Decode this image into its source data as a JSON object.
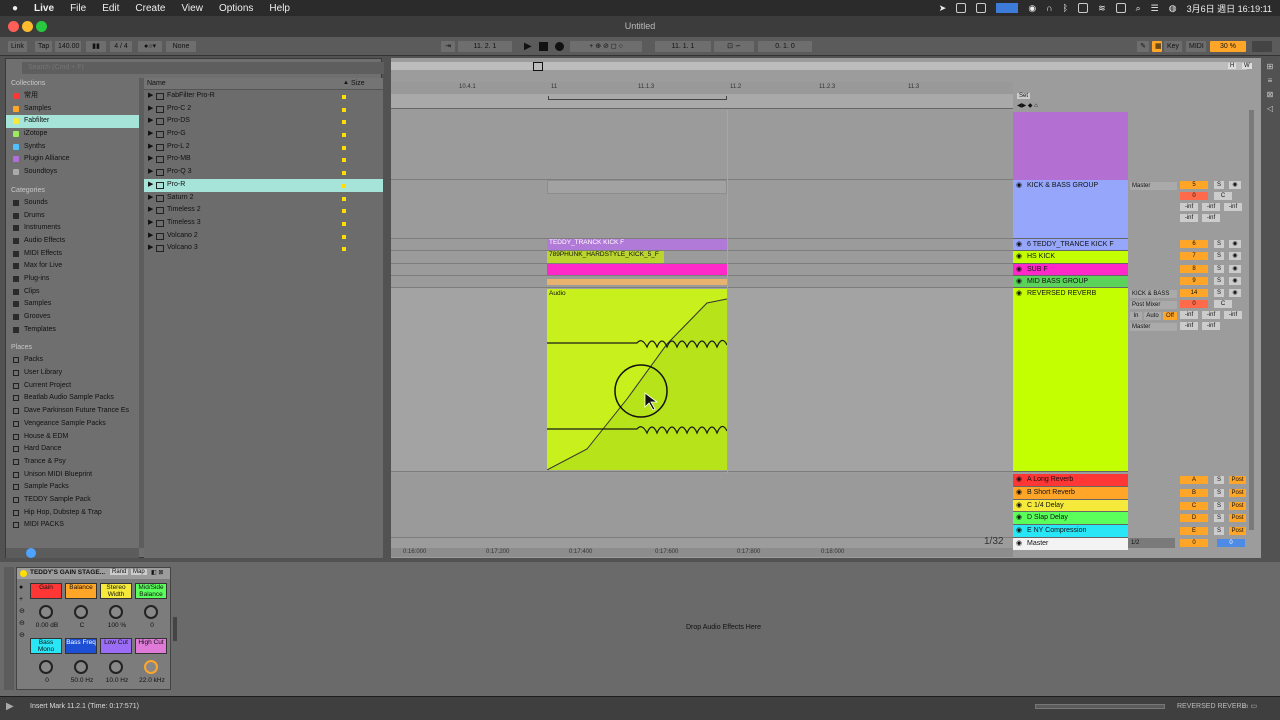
{
  "menubar": {
    "apple": "",
    "app": "Live",
    "items": [
      "File",
      "Edit",
      "Create",
      "View",
      "Options",
      "Help"
    ],
    "datetime": "3月6日 週日 16:19:11"
  },
  "window": {
    "title": "Untitled"
  },
  "control": {
    "link": "Link",
    "tap": "Tap",
    "bpm": "140.00",
    "sig": "4 / 4",
    "quant": "None",
    "pos": "11. 2. 1",
    "loop_start": "11. 1. 1",
    "loop_len": "0. 1. 0",
    "key": "Key",
    "midi": "MIDI",
    "zoom": "30 %"
  },
  "browser": {
    "search_placeholder": "Search (Cmd + F)",
    "collections_header": "Collections",
    "collections": [
      {
        "label": "常用",
        "color": "#ff3636"
      },
      {
        "label": "Samples",
        "color": "#ffa629"
      },
      {
        "label": "Fabfilter",
        "color": "#f5ea3c"
      },
      {
        "label": "iZotope",
        "color": "#9aeb5d"
      },
      {
        "label": "Synths",
        "color": "#52c1ff"
      },
      {
        "label": "Plugin Alliance",
        "color": "#b26edd"
      },
      {
        "label": "Soundtoys",
        "color": "#aaaaaa"
      }
    ],
    "categories_header": "Categories",
    "categories": [
      "Sounds",
      "Drums",
      "Instruments",
      "Audio Effects",
      "MIDI Effects",
      "Max for Live",
      "Plug-ins",
      "Clips",
      "Samples",
      "Grooves",
      "Templates"
    ],
    "places_header": "Places",
    "places": [
      "Packs",
      "User Library",
      "Current Project",
      "Beatlab Audio Sample Packs",
      "Dave Parkinson Future Trance Es",
      "Vengeance Sample Packs",
      "House & EDM",
      "Hard Dance",
      "Trance & Psy",
      "Unison MIDI Blueprint",
      "Sample Packs",
      "TEDDY Sample Pack",
      "Hip Hop, Dubstep & Trap",
      "MIDI PACKS"
    ],
    "col_name": "Name",
    "col_size": "Size",
    "files": [
      "FabFilter Pro-R",
      "Pro-C 2",
      "Pro-DS",
      "Pro-G",
      "Pro-L 2",
      "Pro-MB",
      "Pro-Q 3",
      "Pro-R",
      "Saturn 2",
      "Timeless 2",
      "Timeless 3",
      "Volcano 2",
      "Volcano 3"
    ]
  },
  "arrangement": {
    "ruler": [
      "10.4.1",
      "11",
      "11.1.3",
      "11.2",
      "11.2.3",
      "11.3"
    ],
    "time_ruler": [
      "0:16:000",
      "0:17:200",
      "0:17:400",
      "0:17:600",
      "0:17:800",
      "0:18:000"
    ],
    "set_label": "Set",
    "page": "1/32",
    "clips": {
      "teddy": "TEDDY_TRANCK KICK F",
      "hardstyle": "789PHUNK_HARDSTYLE_KICK_5_F",
      "audio": "Audio"
    },
    "tracks": [
      {
        "name": "KICK & BASS GROUP",
        "color": "#96a7fb",
        "n": "5"
      },
      {
        "name": "6 TEDDY_TRANCE KICK F",
        "color": "#96a7fb",
        "n": "6"
      },
      {
        "name": "HS KICK",
        "color": "#c3ff00",
        "n": "7"
      },
      {
        "name": "SUB F",
        "color": "#ff28c9",
        "n": "8"
      },
      {
        "name": "MID BASS GROUP",
        "color": "#5bd35b",
        "n": "9"
      },
      {
        "name": "REVERSED REVERB",
        "color": "#c3ff00",
        "n": "14"
      }
    ],
    "returns": [
      {
        "name": "A Long Reverb",
        "color": "#ff3636",
        "n": "A"
      },
      {
        "name": "B Short Reverb",
        "color": "#ffa629",
        "n": "B"
      },
      {
        "name": "C 1/4 Delay",
        "color": "#f5ea3c",
        "n": "C"
      },
      {
        "name": "D Slap Delay",
        "color": "#5bff5b",
        "n": "D"
      },
      {
        "name": "E NY Compression",
        "color": "#28e6f5",
        "n": "E"
      }
    ],
    "master": "Master",
    "master_route": "1/2",
    "master_vol": "0",
    "master_pan": "0",
    "routing": {
      "out_master": "Master",
      "kick_bass": "KICK & BASS",
      "post_mixer": "Post Mixer",
      "in": "In",
      "auto": "Auto",
      "off": "Off",
      "inf": "-inf",
      "c": "C",
      "s": "S",
      "post": "Post"
    }
  },
  "device": {
    "title": "TEDDY'S GAIN STAGE...",
    "rand": "Rand",
    "map": "Map",
    "drop_hint": "Drop Audio Effects Here",
    "macros": [
      {
        "label": "Gain",
        "value": "0.00 dB",
        "color": "#ff3636"
      },
      {
        "label": "Balance",
        "value": "C",
        "color": "#ffa629"
      },
      {
        "label": "Stereo Width",
        "value": "100 %",
        "color": "#f5ea3c"
      },
      {
        "label": "Mid/Side Balance",
        "value": "0",
        "color": "#5bff5b"
      },
      {
        "label": "Bass Mono",
        "value": "0",
        "color": "#28e6f5"
      },
      {
        "label": "Bass Freq",
        "value": "50.0 Hz",
        "color": "#1d4fd6"
      },
      {
        "label": "Low Cut",
        "value": "10.0 Hz",
        "color": "#9b6cf5"
      },
      {
        "label": "High Cut",
        "value": "22.0 kHz",
        "color": "#e07ad9"
      }
    ]
  },
  "statusbar": {
    "message": "Insert Mark 11.2.1 (Time: 0:17:571)",
    "track": "REVERSED REVERB"
  }
}
